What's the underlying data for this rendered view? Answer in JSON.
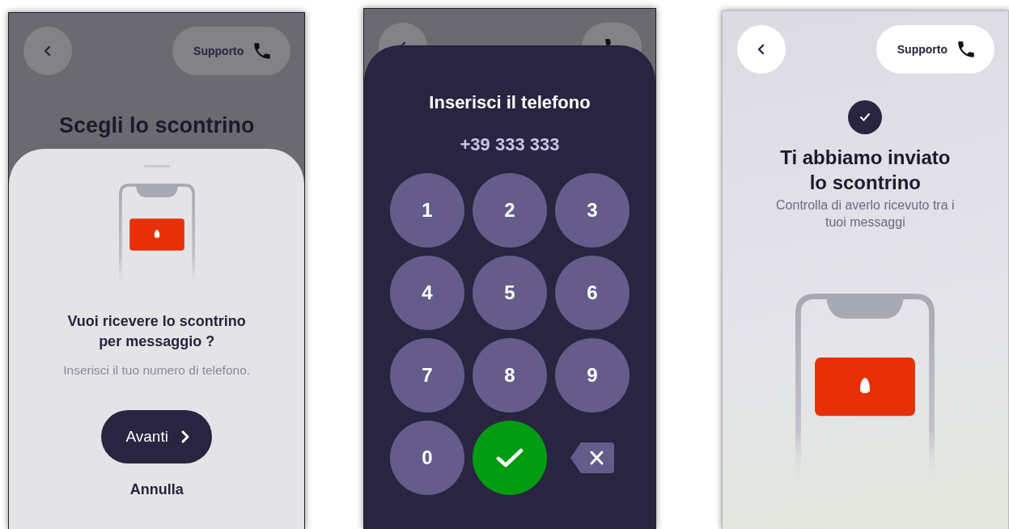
{
  "screens": [
    {
      "kind": "choice",
      "dimmed": true,
      "support": "Supporto",
      "title": "Scegli lo scontrino",
      "question": "Vuoi ricevere lo scontrino per messaggio ?",
      "hint": "Inserisci il tuo numero di telefono.",
      "primary": "Avanti",
      "secondary": "Annulla"
    },
    {
      "kind": "keypad",
      "dimmed": true,
      "title": "Inserisci il telefono",
      "phone": "+39 333 333",
      "keys": [
        {
          "kind": "digit",
          "label": "1"
        },
        {
          "kind": "digit",
          "label": "2"
        },
        {
          "kind": "digit",
          "label": "3"
        },
        {
          "kind": "digit",
          "label": "4"
        },
        {
          "kind": "digit",
          "label": "5"
        },
        {
          "kind": "digit",
          "label": "6"
        },
        {
          "kind": "digit",
          "label": "7"
        },
        {
          "kind": "digit",
          "label": "8"
        },
        {
          "kind": "digit",
          "label": "9"
        },
        {
          "kind": "digit",
          "label": "0"
        },
        {
          "kind": "confirm"
        },
        {
          "kind": "delete"
        }
      ]
    },
    {
      "kind": "sent",
      "dimmed": false,
      "support": "Supporto",
      "title": "Ti abbiamo inviato lo scontrino",
      "subtitle": "Controlla di averlo ricevuto tra i tuoi messaggi"
    }
  ]
}
